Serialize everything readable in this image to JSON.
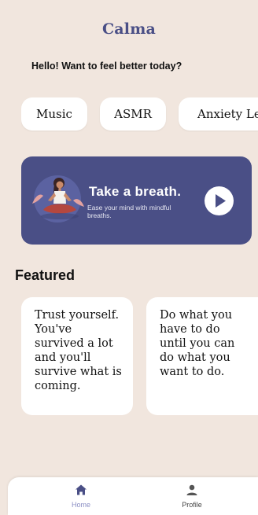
{
  "app": {
    "title": "Calma"
  },
  "greeting": "Hello! Want to feel better today?",
  "categories": [
    {
      "label": "Music"
    },
    {
      "label": "ASMR"
    },
    {
      "label": "Anxiety Lev"
    }
  ],
  "banner": {
    "title": "Take a breath.",
    "subtitle": "Ease your mind with mindful breaths.",
    "icon": "play-icon"
  },
  "featured": {
    "title": "Featured",
    "quotes": [
      {
        "text": "Trust yourself. You've survived a lot and you'll survive what is coming."
      },
      {
        "text": "Do what you have to do until you can do what you want to do."
      }
    ]
  },
  "nav": {
    "items": [
      {
        "label": "Home",
        "icon": "home-icon",
        "active": true
      },
      {
        "label": "Profile",
        "icon": "person-icon",
        "active": false
      }
    ]
  },
  "colors": {
    "background": "#f1e6de",
    "accent": "#4a4f86",
    "nav_active": "#8b8fc4"
  }
}
